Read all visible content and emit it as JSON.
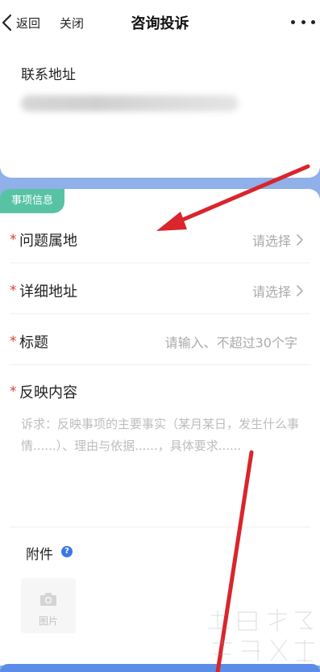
{
  "navbar": {
    "back_label": "返回",
    "close_label": "关闭",
    "title": "咨询投诉",
    "more_icon": "more-dots-icon"
  },
  "contact": {
    "label": "联系地址"
  },
  "section": {
    "tag": "事项信息"
  },
  "form": {
    "rows": [
      {
        "label": "问题属地",
        "placeholder": "请选择",
        "required": true
      },
      {
        "label": "详细地址",
        "placeholder": "请选择",
        "required": true
      },
      {
        "label": "标题",
        "placeholder": "请输入、不超过30个字",
        "required": true
      }
    ],
    "content": {
      "label": "反映内容",
      "required": true,
      "placeholder": "诉求：反映事项的主要事实（某月某日，发生什么事情......）、理由与依据......，具体要求......"
    },
    "required_mark": "*"
  },
  "attachment": {
    "label": "附件",
    "help_icon": "question-circle-icon",
    "upload_label": "图片",
    "upload_icon": "camera-icon"
  },
  "colors": {
    "accent_blue": "#5b8de8",
    "tag_green": "#58c3a4",
    "required_red": "#e53935",
    "arrow_red": "#d9252b",
    "page_bg": "#8fb0e8"
  }
}
